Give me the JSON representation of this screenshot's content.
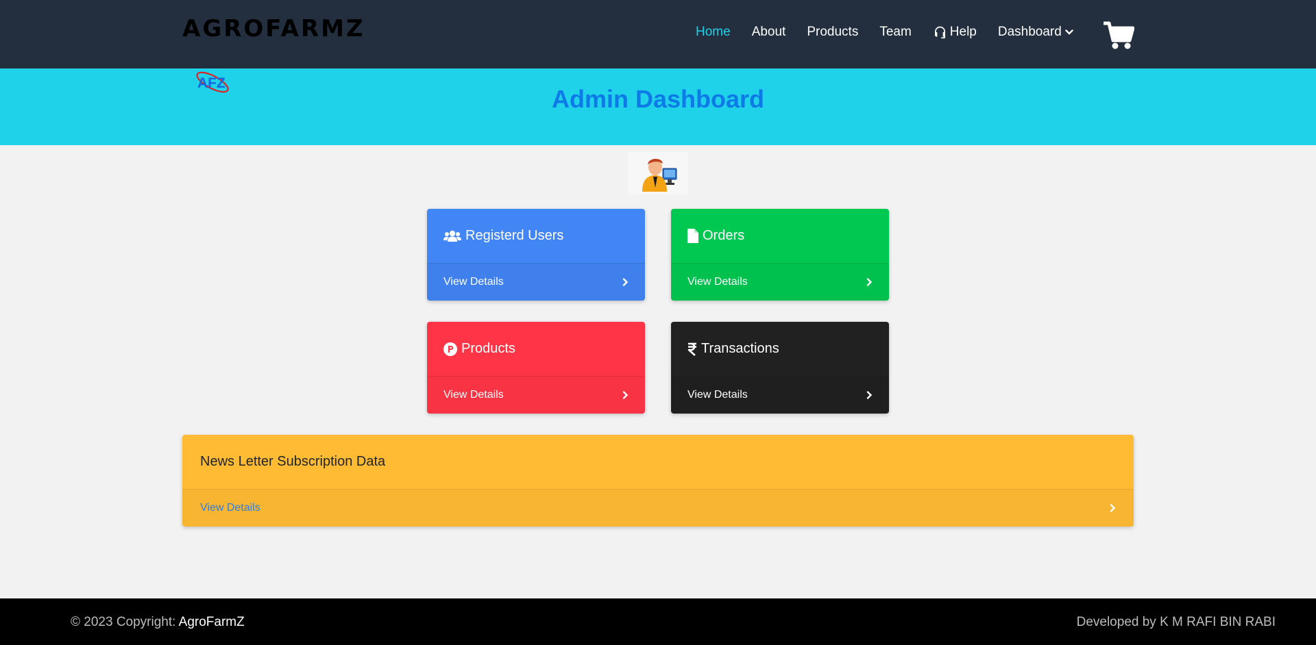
{
  "header": {
    "brand": "AGROFARMZ",
    "nav": [
      {
        "label": "Home"
      },
      {
        "label": "About"
      },
      {
        "label": "Products"
      },
      {
        "label": "Team"
      },
      {
        "label": "Help",
        "icon": "headset-icon"
      },
      {
        "label": "Dashboard",
        "icon": "chevron-down-icon"
      }
    ],
    "cart_icon": "shopping-cart-icon",
    "active_color": "#1dd3ea",
    "bg_color": "#232f3e"
  },
  "banner": {
    "title": "Admin Dashboard",
    "logo_text": "AFZ",
    "bg_color": "#1fd2ea",
    "title_color": "#0d7ae8"
  },
  "avatar": {
    "icon": "admin-user-icon"
  },
  "cards": [
    {
      "title": "Registerd Users",
      "link": "View Details",
      "icon": "users-icon",
      "color": "#4285f4"
    },
    {
      "title": "Orders",
      "link": "View Details",
      "icon": "file-icon",
      "color": "#00c851"
    },
    {
      "title": "Products",
      "link": "View Details",
      "icon": "product-hunt-icon",
      "color": "#ff3547"
    },
    {
      "title": "Transactions",
      "link": "View Details",
      "icon": "rupee-icon",
      "color": "#212121"
    }
  ],
  "newsletter": {
    "title": "News Letter Subscription Data",
    "link": "View Details",
    "color": "#ffbb33"
  },
  "footer": {
    "copyright": "© 2023 Copyright: ",
    "brand": "AgroFarmZ",
    "developer": "Developed by K M RAFI BIN RABI"
  }
}
